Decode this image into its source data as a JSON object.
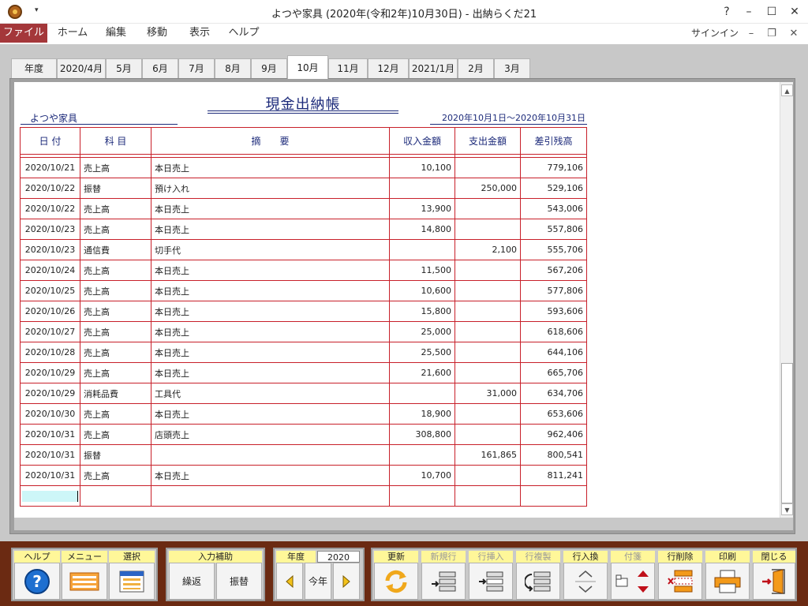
{
  "window": {
    "title": "よつや家具 (2020年(令和2年)10月30日) - 出納らくだ21",
    "help": "?"
  },
  "menu": {
    "items": [
      "ファイル",
      "ホーム",
      "編集",
      "移動",
      "表示",
      "ヘルプ"
    ],
    "signin": "サインイン"
  },
  "tabs": [
    {
      "label": "年度"
    },
    {
      "label": "2020/4月"
    },
    {
      "label": "5月"
    },
    {
      "label": "6月"
    },
    {
      "label": "7月"
    },
    {
      "label": "8月"
    },
    {
      "label": "9月"
    },
    {
      "label": "10月",
      "active": true
    },
    {
      "label": "11月"
    },
    {
      "label": "12月"
    },
    {
      "label": "2021/1月"
    },
    {
      "label": "2月"
    },
    {
      "label": "3月"
    }
  ],
  "ledger": {
    "title": "現金出納帳",
    "company": "よつや家具",
    "period": "2020年10月1日～2020年10月31日",
    "headers": {
      "date": "日 付",
      "account": "科 目",
      "description": "摘　　要",
      "income": "収入金額",
      "expense": "支出金額",
      "balance": "差引残高"
    },
    "rows": [
      {
        "date": "2020/10/21",
        "account": "売上高",
        "description": "本日売上",
        "income": "10,100",
        "expense": "",
        "balance": "779,106"
      },
      {
        "date": "2020/10/22",
        "account": "振替",
        "description": "預け入れ",
        "income": "",
        "expense": "250,000",
        "balance": "529,106"
      },
      {
        "date": "2020/10/22",
        "account": "売上高",
        "description": "本日売上",
        "income": "13,900",
        "expense": "",
        "balance": "543,006"
      },
      {
        "date": "2020/10/23",
        "account": "売上高",
        "description": "本日売上",
        "income": "14,800",
        "expense": "",
        "balance": "557,806"
      },
      {
        "date": "2020/10/23",
        "account": "通信費",
        "description": "切手代",
        "income": "",
        "expense": "2,100",
        "balance": "555,706"
      },
      {
        "date": "2020/10/24",
        "account": "売上高",
        "description": "本日売上",
        "income": "11,500",
        "expense": "",
        "balance": "567,206"
      },
      {
        "date": "2020/10/25",
        "account": "売上高",
        "description": "本日売上",
        "income": "10,600",
        "expense": "",
        "balance": "577,806"
      },
      {
        "date": "2020/10/26",
        "account": "売上高",
        "description": "本日売上",
        "income": "15,800",
        "expense": "",
        "balance": "593,606"
      },
      {
        "date": "2020/10/27",
        "account": "売上高",
        "description": "本日売上",
        "income": "25,000",
        "expense": "",
        "balance": "618,606"
      },
      {
        "date": "2020/10/28",
        "account": "売上高",
        "description": "本日売上",
        "income": "25,500",
        "expense": "",
        "balance": "644,106"
      },
      {
        "date": "2020/10/29",
        "account": "売上高",
        "description": "本日売上",
        "income": "21,600",
        "expense": "",
        "balance": "665,706"
      },
      {
        "date": "2020/10/29",
        "account": "消耗品費",
        "description": "工具代",
        "income": "",
        "expense": "31,000",
        "balance": "634,706"
      },
      {
        "date": "2020/10/30",
        "account": "売上高",
        "description": "本日売上",
        "income": "18,900",
        "expense": "",
        "balance": "653,606"
      },
      {
        "date": "2020/10/31",
        "account": "売上高",
        "description": "店頭売上",
        "income": "308,800",
        "expense": "",
        "balance": "962,406"
      },
      {
        "date": "2020/10/31",
        "account": "振替",
        "description": "",
        "income": "",
        "expense": "161,865",
        "balance": "800,541"
      },
      {
        "date": "2020/10/31",
        "account": "売上高",
        "description": "本日売上",
        "income": "10,700",
        "expense": "",
        "balance": "811,241"
      }
    ]
  },
  "toolbar": {
    "help": "ヘルプ",
    "menu": "メニュー",
    "select": "選択",
    "input_assist": "入力補助",
    "repeat": "繰返",
    "transfer": "振替",
    "year_label": "年度",
    "year_value": "2020",
    "this_year": "今年",
    "update": "更新",
    "new_row": "新規行",
    "insert_row": "行挿入",
    "copy_row": "行複製",
    "swap_row": "行入換",
    "tag": "付箋",
    "delete_row": "行削除",
    "print": "印刷",
    "close": "閉じる"
  },
  "colors": {
    "accent_file_menu": "#a4373a",
    "grid_red": "#c8202a",
    "ledger_blue": "#1c2a7a",
    "toolbar_bg": "#6b2a12",
    "label_yellow": "#fff799"
  }
}
